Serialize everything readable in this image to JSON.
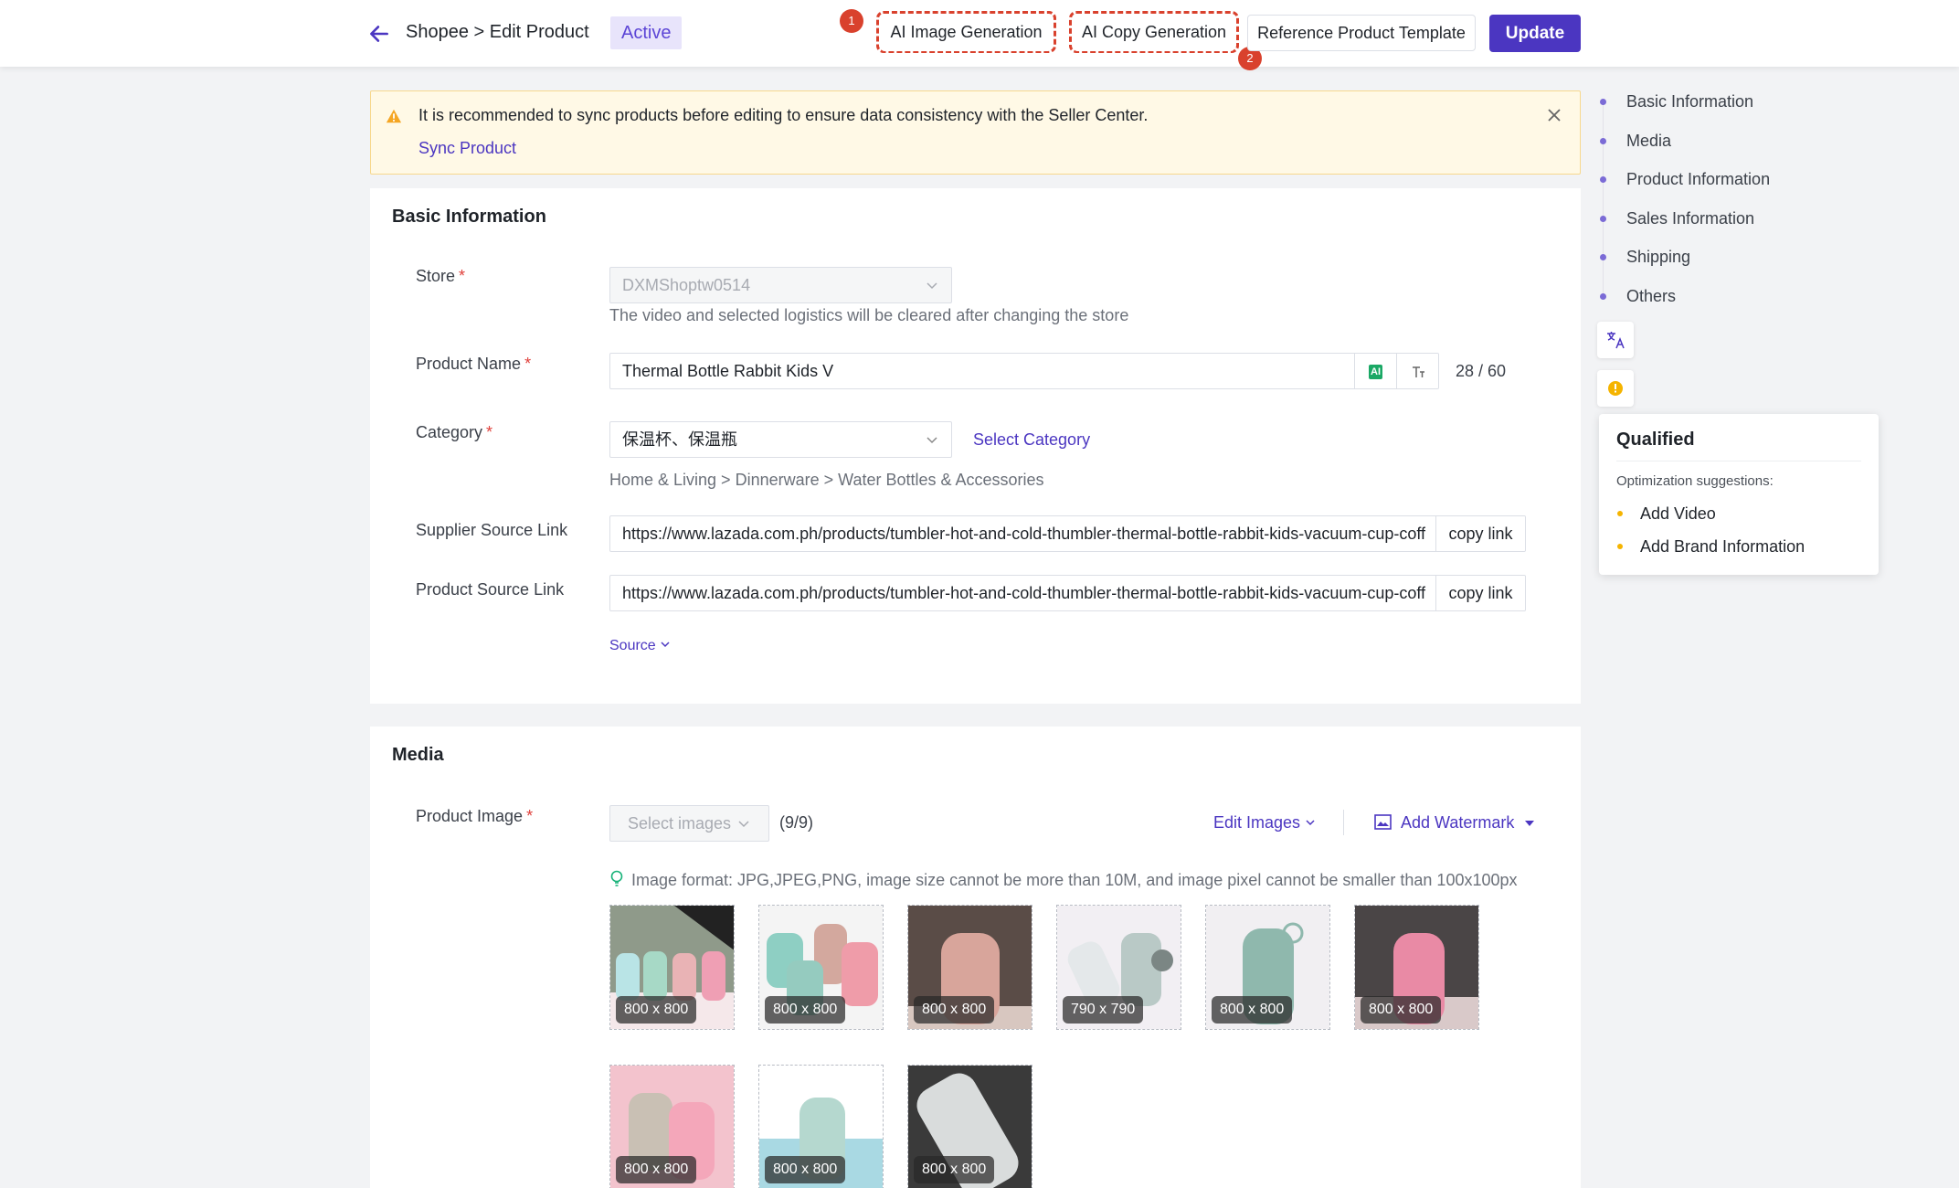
{
  "header": {
    "breadcrumb": "Shopee > Edit Product",
    "status": "Active",
    "ai_image_label": "AI Image Generation",
    "ai_copy_label": "AI Copy Generation",
    "reference_label": "Reference Product Template",
    "update_label": "Update",
    "badge_1": "1",
    "badge_2": "2"
  },
  "alert": {
    "message": "It is recommended to sync products before editing to ensure data consistency with the Seller Center.",
    "link": "Sync Product"
  },
  "basic": {
    "title": "Basic Information",
    "store_label": "Store",
    "store_value": "DXMShoptw0514",
    "store_hint": "The video and selected logistics will be cleared after changing the store",
    "name_label": "Product Name",
    "name_value": "Thermal Bottle Rabbit Kids V",
    "ai_tag": "AI",
    "name_count": "28 / 60",
    "category_label": "Category",
    "category_value": "保温杯、保温瓶",
    "select_category": "Select Category",
    "category_path": "Home & Living > Dinnerware > Water Bottles & Accessories",
    "supplier_label": "Supplier Source Link",
    "supplier_value": "https://www.lazada.com.ph/products/tumbler-hot-and-cold-thumbler-thermal-bottle-rabbit-kids-vacuum-cup-coff",
    "product_source_label": "Product Source Link",
    "product_source_value": "https://www.lazada.com.ph/products/tumbler-hot-and-cold-thumbler-thermal-bottle-rabbit-kids-vacuum-cup-coff",
    "copy_link": "copy link",
    "source_toggle": "Source"
  },
  "media": {
    "title": "Media",
    "image_label": "Product Image",
    "select_placeholder": "Select images",
    "image_count": "(9/9)",
    "edit_images": "Edit Images",
    "add_watermark": "Add Watermark",
    "image_hint": "Image format: JPG,JPEG,PNG, image size cannot be more than 10M, and image pixel cannot be smaller than 100x100px",
    "images": [
      {
        "size": "800 x 800"
      },
      {
        "size": "800 x 800"
      },
      {
        "size": "800 x 800"
      },
      {
        "size": "790 x 790"
      },
      {
        "size": "800 x 800"
      },
      {
        "size": "800 x 800"
      },
      {
        "size": "800 x 800"
      },
      {
        "size": "800 x 800"
      },
      {
        "size": "800 x 800"
      }
    ]
  },
  "side_nav": {
    "items": [
      "Basic Information",
      "Media",
      "Product Information",
      "Sales Information",
      "Shipping",
      "Others"
    ]
  },
  "quality": {
    "title": "Qualified",
    "subtitle": "Optimization suggestions:",
    "suggestions": [
      "Add Video",
      "Add Brand Information"
    ]
  },
  "colors": {
    "brand": "#4b36c1",
    "danger": "#d9412d",
    "warning_bg": "#fff9e6"
  }
}
